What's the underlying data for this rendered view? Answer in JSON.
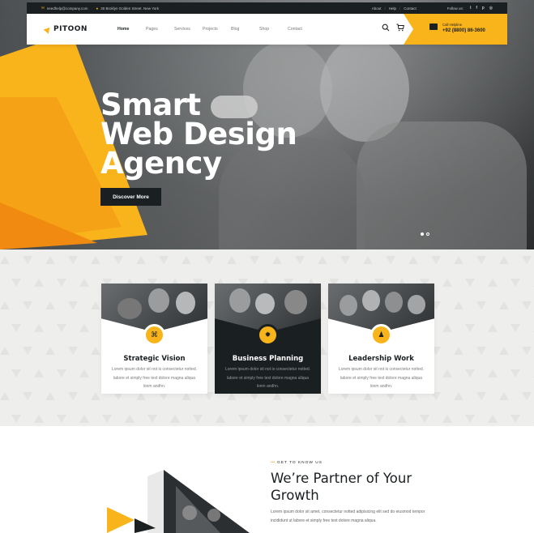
{
  "topbar": {
    "email": "needhelp@company.com",
    "address": "30 Broklyn Golden Street. New York",
    "links": [
      "About",
      "Help",
      "Contact"
    ],
    "follow_label": "Follow us:",
    "social_icons": [
      "twitter-icon",
      "facebook-icon",
      "pinterest-icon",
      "instagram-icon"
    ]
  },
  "header": {
    "logo_text": "PITOON",
    "nav": [
      "Home",
      "Pages",
      "Services",
      "Projects",
      "Blog",
      "Shop",
      "Contact"
    ],
    "active_nav": "Home",
    "cta_label": "Call Helpline",
    "cta_number": "+92 (8800) 86-3600"
  },
  "hero": {
    "title_line1": "Smart",
    "title_line2": "Web Design",
    "title_line3": "Agency",
    "button": "Discover More"
  },
  "features": [
    {
      "title": "Strategic Vision",
      "text": "Lorem ipsum dolor sit not is consectetur notted. labore et simply free text dolore magna aliqua lonm andhn.",
      "icon": "strategy-icon",
      "dark": false
    },
    {
      "title": "Business Planning",
      "text": "Lorem ipsum dolor sit not is consectetur notted. labore et simply free text dolore magna aliqua lonm andhn.",
      "icon": "lightbulb-icon",
      "dark": true
    },
    {
      "title": "Leadership Work",
      "text": "Lorem ipsum dolor sit not is consectetur notted. labore et simply free text dolore magna aliqua lonm andhn.",
      "icon": "chess-icon",
      "dark": false
    }
  ],
  "about": {
    "kicker": "GET TO KNOW US",
    "title_line1": "We’re Partner of Your",
    "title_line2": "Growth",
    "text": "Lorem ipsum dolor sit amet, consectetur notted adipisicing elit sed do eiusmod tempor incididunt ut labore et simply free text dolore magna aliqua."
  },
  "colors": {
    "accent": "#f9b31b",
    "dark": "#1a1f21"
  }
}
